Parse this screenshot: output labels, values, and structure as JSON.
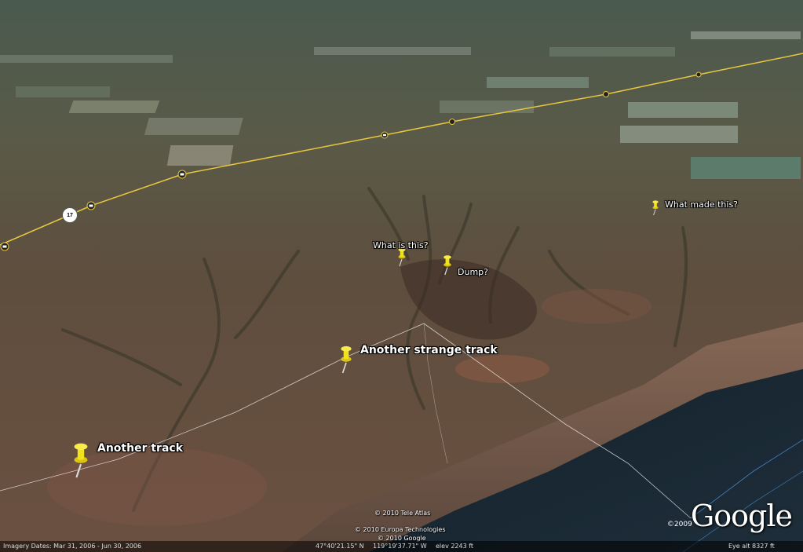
{
  "placemarks": [
    {
      "id": "what-made-this",
      "label": "What made this?",
      "size": "small"
    },
    {
      "id": "what-is-this",
      "label": "What is this?",
      "size": "small"
    },
    {
      "id": "dump",
      "label": "Dump?",
      "size": "small"
    },
    {
      "id": "another-strange-track",
      "label": "Another strange track",
      "size": "large"
    },
    {
      "id": "another-track",
      "label": "Another track",
      "size": "large"
    }
  ],
  "road": {
    "shield": "17"
  },
  "credits": {
    "tele_atlas": "© 2010 Tele Atlas",
    "europa": "© 2010 Europa Technologies",
    "google": "© 2010 Google"
  },
  "status": {
    "imagery_dates": "Imagery Dates: Mar 31, 2006 - Jun 30, 2006",
    "lat": "47°40'21.15\" N",
    "lon": "119°19'37.71\" W",
    "elev": "elev  2243 ft",
    "eye_alt": "Eye alt    8327 ft"
  },
  "logo": {
    "year": "©2009",
    "text": "Google"
  },
  "colors": {
    "pin": "#f2e21b",
    "road": "#e8c640",
    "track": "#ffffff",
    "water": "#1a2530"
  },
  "icons": {
    "placemark": "yellow-pushpin-icon",
    "road_marker": "camera-icon"
  }
}
